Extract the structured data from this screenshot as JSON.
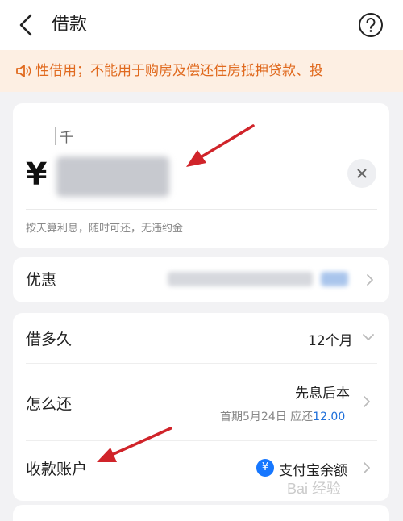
{
  "header": {
    "title": "借款",
    "back_icon": "chevron-left-icon",
    "help_icon": "question-circle-icon"
  },
  "notice": {
    "icon": "speaker-icon",
    "text": "性借用；不能用于购房及偿还住房抵押贷款、投"
  },
  "amount": {
    "unit_label": "千",
    "currency_symbol": "¥",
    "clear_icon": "close-icon",
    "hint": "按天算利息，随时可还，无违约金"
  },
  "promo": {
    "label": "优惠"
  },
  "terms": {
    "duration_label": "借多久",
    "duration_value": "12个月",
    "repay_label": "怎么还",
    "repay_method": "先息后本",
    "repay_detail_prefix": "首期5月24日 应还",
    "repay_detail_amount": "12.00",
    "account_label": "收款账户",
    "account_value": "支付宝余额",
    "account_icon_glyph": "¥"
  },
  "watermark": {
    "text": "Bai 经验"
  },
  "colors": {
    "notice_bg": "#fdefe3",
    "notice_text": "#e06a1f",
    "accent_blue": "#1e6fd9",
    "arrow_red": "#d0242a"
  }
}
